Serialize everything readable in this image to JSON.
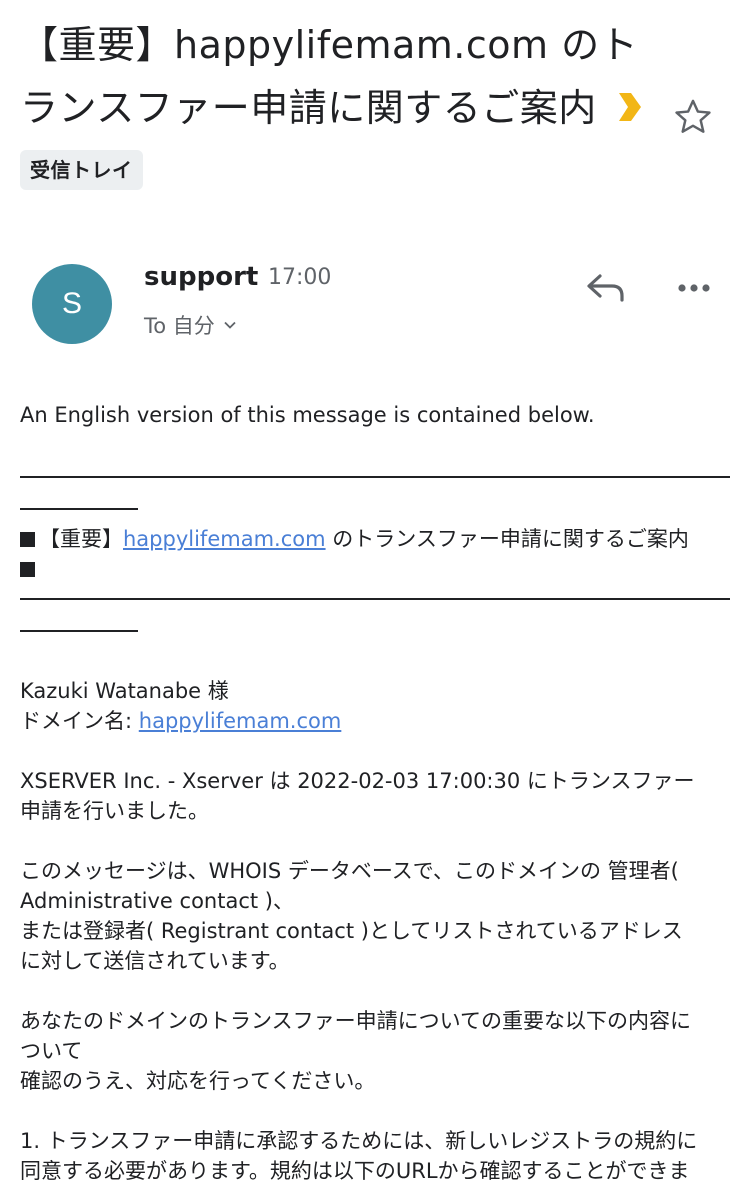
{
  "subject": "【重要】happylifemam.com のトランスファー申請に関するご案内",
  "label": {
    "text": "受信トレイ",
    "color": "#f2b616"
  },
  "sender": {
    "initial": "S",
    "name": "support",
    "time": "17:00",
    "recipient": "To 自分",
    "avatar_color": "#3f8fa3"
  },
  "icons": [
    "star-icon",
    "reply-icon",
    "more-icon",
    "chevron-down-icon"
  ],
  "body": {
    "intro": "An English version of this message is contained below.",
    "title_prefix": "【重要】",
    "title_link": "happylifemam.com",
    "title_suffix": " のトランスファー申請に関するご案内",
    "greeting": "Kazuki Watanabe 様",
    "domain_label": "ドメイン名: ",
    "domain_link": "happylifemam.com",
    "p1_line1": "XSERVER Inc. - Xserver は 2022-02-03 17:00:30 にトランスファー",
    "p1_line2": "申請を行いました。",
    "p2_line1": "このメッセージは、WHOIS データベースで、このドメインの 管理者(",
    "p2_line2": "Administrative contact )、",
    "p2_line3": "または登録者( Registrant contact )としてリストされているアドレス",
    "p2_line4": "に対して送信されています。",
    "p3_line1": "あなたのドメインのトランスファー申請についての重要な以下の内容に",
    "p3_line2": "ついて",
    "p3_line3": "確認のうえ、対応を行ってください。",
    "p4_line1": "1. トランスファー申請に承認するためには、新しいレジストラの規約に",
    "p4_line2": "同意する必要があります。規約は以下のURLから確認することができま"
  }
}
